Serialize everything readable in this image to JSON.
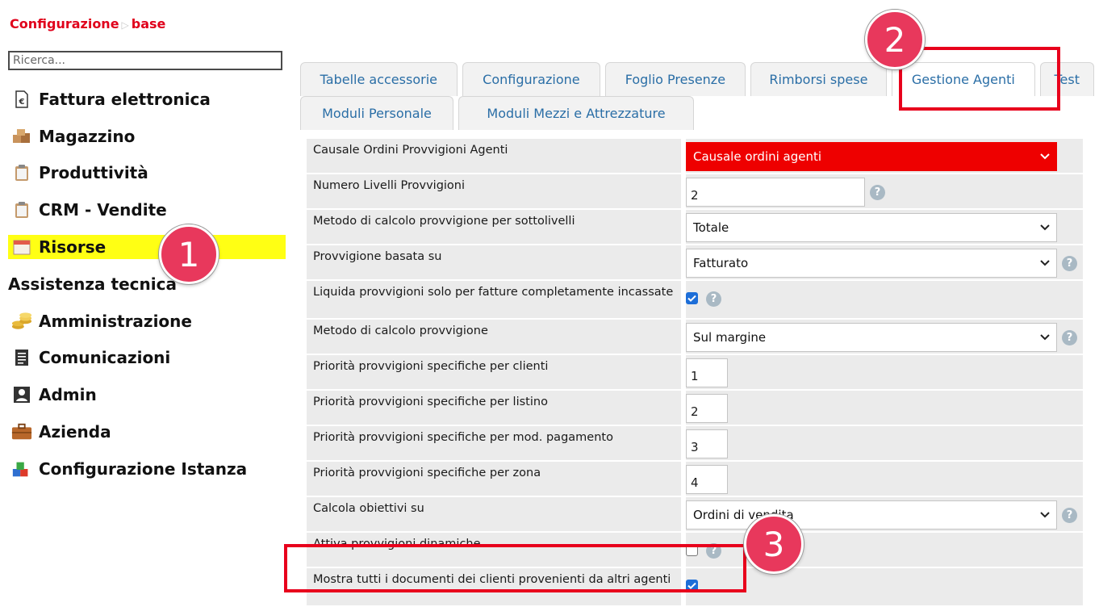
{
  "breadcrumb": {
    "part1": "Configurazione",
    "separator": "▷",
    "part2": "base"
  },
  "search": {
    "placeholder": "Ricerca..."
  },
  "sidebar": {
    "items": [
      {
        "label": "Fattura elettronica",
        "icon": "invoice-euro-icon"
      },
      {
        "label": "Magazzino",
        "icon": "boxes-icon"
      },
      {
        "label": "Produttività",
        "icon": "clipboard-icon"
      },
      {
        "label": "CRM - Vendite",
        "icon": "clipboard-icon"
      },
      {
        "label": "Risorse",
        "icon": "calendar-icon",
        "active": true
      },
      {
        "label": "Assistenza tecnica",
        "icon": "none"
      },
      {
        "label": "Amministrazione",
        "icon": "coins-icon"
      },
      {
        "label": "Comunicazioni",
        "icon": "document-icon"
      },
      {
        "label": "Admin",
        "icon": "user-icon"
      },
      {
        "label": "Azienda",
        "icon": "briefcase-icon"
      },
      {
        "label": "Configurazione Istanza",
        "icon": "blocks-icon"
      }
    ]
  },
  "tabs": {
    "row1": [
      "Tabelle accessorie",
      "Configurazione",
      "Foglio Presenze",
      "Rimborsi spese",
      "Gestione Agenti",
      "Test"
    ],
    "row2": [
      "Moduli Personale",
      "Moduli Mezzi e Attrezzature"
    ],
    "active": "Gestione Agenti"
  },
  "form": {
    "rows": [
      {
        "label": "Causale Ordini Provvigioni Agenti",
        "type": "select",
        "value": "Causale ordini agenti",
        "highlight": true,
        "help": false
      },
      {
        "label": "Numero Livelli Provvigioni",
        "type": "text",
        "value": "2",
        "help": true
      },
      {
        "label": "Metodo di calcolo provvigione per sottolivelli",
        "type": "select",
        "value": "Totale",
        "help": false
      },
      {
        "label": "Provvigione basata su",
        "type": "select",
        "value": "Fatturato",
        "help": true
      },
      {
        "label": "Liquida provvigioni solo per fatture completamente incassate",
        "type": "checkbox",
        "checked": true,
        "help": true
      },
      {
        "label": "Metodo di calcolo provvigione",
        "type": "select",
        "value": "Sul margine",
        "help": true
      },
      {
        "label": "Priorità provvigioni specifiche per clienti",
        "type": "text",
        "value": "1",
        "help": false
      },
      {
        "label": "Priorità provvigioni specifiche per listino",
        "type": "text",
        "value": "2",
        "help": false
      },
      {
        "label": "Priorità provvigioni specifiche per mod. pagamento",
        "type": "text",
        "value": "3",
        "help": false
      },
      {
        "label": "Priorità provvigioni specifiche per zona",
        "type": "text",
        "value": "4",
        "help": false
      },
      {
        "label": "Calcola obiettivi su",
        "type": "select",
        "value": "Ordini di vendita",
        "help": true
      },
      {
        "label": "Attiva provvigioni dinamiche",
        "type": "checkbox",
        "checked": false,
        "help": true
      },
      {
        "label": "Mostra tutti i documenti dei clienti provenienti da altri agenti",
        "type": "checkbox",
        "checked": true,
        "help": false
      }
    ]
  },
  "annotations": {
    "one": "1",
    "two": "2",
    "three": "3"
  },
  "colors": {
    "accent_red": "#e0001b",
    "highlight_yellow": "#ffff14",
    "tab_text": "#2a6ea6",
    "callout": "#e8385c",
    "checkbox_blue": "#1d6ed8"
  }
}
